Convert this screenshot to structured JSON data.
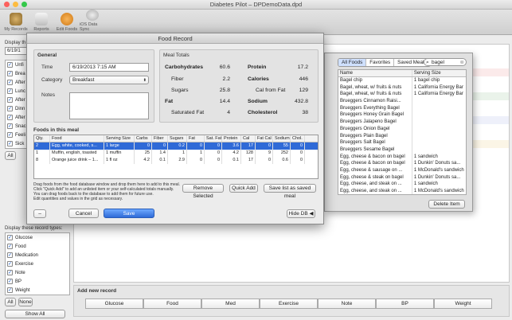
{
  "window": {
    "title": "Diabetes Pilot – DPDemoData.dpd"
  },
  "toolbar": {
    "items": [
      {
        "label": "My Records",
        "icon": "records-icon"
      },
      {
        "label": "Reports",
        "icon": "reports-icon"
      },
      {
        "label": "Edit Foods",
        "icon": "food-icon"
      },
      {
        "label": "iOS Data Sync",
        "icon": "sync-icon"
      }
    ]
  },
  "left": {
    "display_label": "Display th",
    "date": "6/19/1",
    "types": [
      "Unfi",
      "Brea",
      "After",
      "Lunc",
      "After",
      "Dinn",
      "After",
      "Snac",
      "Feeli",
      "Sick"
    ],
    "all_btn": "All"
  },
  "left_bottom": {
    "label": "Display these record types:",
    "types": [
      "Glucose",
      "Food",
      "Medication",
      "Exercise",
      "Note",
      "BP",
      "Weight"
    ],
    "all_btn": "All",
    "none_btn": "None",
    "show_all_btn": "Show All"
  },
  "add_new": {
    "label": "Add new record",
    "buttons": [
      "Glucose",
      "Food",
      "Med",
      "Exercise",
      "Note",
      "BP",
      "Weight"
    ]
  },
  "dialog": {
    "title": "Food Record",
    "general": {
      "title": "General",
      "time_label": "Time",
      "time_value": "6/19/2013  7:15 AM",
      "category_label": "Category",
      "category_value": "Breakfast",
      "notes_label": "Notes",
      "notes_value": ""
    },
    "totals": {
      "title": "Meal Totals",
      "rows": [
        {
          "l1": "Carbohydrates",
          "v1": "60.6",
          "l2": "Protein",
          "v2": "17.2"
        },
        {
          "l1": "Fiber",
          "v1": "2.2",
          "l2": "Calories",
          "v2": "446"
        },
        {
          "l1": "Sugars",
          "v1": "25.8",
          "l2": "Cal from Fat",
          "v2": "129"
        },
        {
          "l1": "Fat",
          "v1": "14.4",
          "l2": "Sodium",
          "v2": "432.8"
        },
        {
          "l1": "Saturated Fat",
          "v1": "4",
          "l2": "Cholesterol",
          "v2": "38"
        }
      ]
    },
    "foods_title": "Foods in this meal",
    "columns": [
      "Qty.",
      "Food",
      "Serving Size",
      "Carbs",
      "Fiber",
      "Sugars",
      "Fat",
      "Sat. Fat",
      "Protein",
      "Cal",
      "Fat Cal",
      "Sodium",
      "Chol."
    ],
    "rows": [
      [
        "2",
        "Egg, white, cooked, s...",
        "1 large",
        "0",
        "0",
        "0.2",
        "0",
        "0",
        "3.6",
        "17",
        "0",
        "55",
        "0"
      ],
      [
        "1",
        "Muffin, english, toasted",
        "1 muffin",
        "25",
        "1.4",
        "1",
        "1",
        "0",
        "4.2",
        "128",
        "9",
        "252",
        "0"
      ],
      [
        "8",
        "Orange juice drink – 1...",
        "1 fl oz",
        "4.2",
        "0.1",
        "2.9",
        "0",
        "0",
        "0.1",
        "17",
        "0",
        "0.6",
        "0"
      ]
    ],
    "help": "Drag foods from the food database window and drop them here to add to this meal.\nClick \"Quick Add\" to add an unlisted item or your self-calculated totals manually.\nYou can drag foods back to the database to add them for future use.\nEdit quantities and values in the grid as necessary.",
    "remove_btn": "Remove Selected",
    "quick_add_btn": "Quick Add",
    "save_list_btn": "Save list as saved meal",
    "minus_btn": "–",
    "cancel_btn": "Cancel",
    "save_btn": "Save",
    "hide_db_btn": "Hide DB ◀"
  },
  "db": {
    "tabs": [
      "All Foods",
      "Favorites",
      "Saved Meals"
    ],
    "search": "bagel",
    "columns": [
      "Name",
      "Serving Size"
    ],
    "rows": [
      [
        "Bagel chip",
        "1 bagel chip"
      ],
      [
        "Bagel, wheat, w/ fruits & nuts",
        "1 California Energy Bar"
      ],
      [
        "Bagel, wheat, w/ fruits & nuts",
        "1 California Energy Bar"
      ],
      [
        "Brueggers Cinnamon Raisi...",
        ""
      ],
      [
        "Brueggers Everything Bagel",
        ""
      ],
      [
        "Brueggers Honey Grain Bagel",
        ""
      ],
      [
        "Brueggers Jalapeno Bagel",
        ""
      ],
      [
        "Brueggers Onion Bagel",
        ""
      ],
      [
        "Brueggers Plain Bagel",
        ""
      ],
      [
        "Brueggers Salt Bagel",
        ""
      ],
      [
        "Brueggers Sesame Bagel",
        ""
      ],
      [
        "Egg, cheese & bacon on bagel",
        "1 sandwich"
      ],
      [
        "Egg, cheese & bacon on bagel",
        "1 Dunkin' Donuts sa..."
      ],
      [
        "Egg, cheese & sausage on ...",
        "1 McDonald's sandwich"
      ],
      [
        "Egg, cheese & steak on bagel",
        "1 Dunkin' Donuts sa..."
      ],
      [
        "Egg, cheese, and steak on ...",
        "1 sandwich"
      ],
      [
        "Egg, cheese, and steak on ...",
        "1 McDonald's sandwich"
      ]
    ],
    "delete_btn": "Delete Item"
  },
  "colors": {
    "selected": "#2f6ad7",
    "accent": "#3b7ee8"
  }
}
